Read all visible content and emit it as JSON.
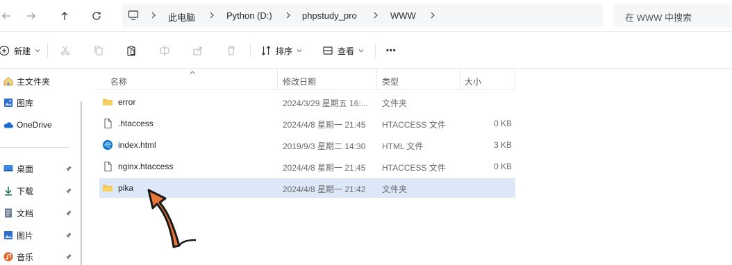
{
  "address": {
    "crumbs": [
      "此电脑",
      "Python (D:)",
      "phpstudy_pro",
      "WWW"
    ],
    "search_placeholder": "在 WWW 中搜索"
  },
  "toolbar": {
    "new_label": "新建",
    "sort_label": "排序",
    "view_label": "查看",
    "more_label": "•••"
  },
  "sidebar": {
    "top": [
      {
        "label": "主文件夹",
        "icon": "home-icon"
      },
      {
        "label": "图库",
        "icon": "gallery-icon"
      },
      {
        "label": "OneDrive",
        "icon": "cloud-icon"
      }
    ],
    "pinned": [
      {
        "label": "桌面",
        "icon": "desktop-icon"
      },
      {
        "label": "下载",
        "icon": "download-icon"
      },
      {
        "label": "文档",
        "icon": "document-icon"
      },
      {
        "label": "图片",
        "icon": "pictures-icon"
      },
      {
        "label": "音乐",
        "icon": "music-icon"
      }
    ]
  },
  "columns": {
    "name": "名称",
    "date": "修改日期",
    "type": "类型",
    "size": "大小"
  },
  "files": [
    {
      "name": "error",
      "date": "2024/3/29 星期五 16:...",
      "type": "文件夹",
      "size": "",
      "icon": "folder-icon"
    },
    {
      "name": ".htaccess",
      "date": "2024/4/8 星期一 21:45",
      "type": "HTACCESS 文件",
      "size": "0 KB",
      "icon": "file-icon"
    },
    {
      "name": "index.html",
      "date": "2019/9/3 星期二 14:30",
      "type": "HTML 文件",
      "size": "3 KB",
      "icon": "edge-icon"
    },
    {
      "name": "nginx.htaccess",
      "date": "2024/4/8 星期一 21:45",
      "type": "HTACCESS 文件",
      "size": "0 KB",
      "icon": "file-icon"
    },
    {
      "name": "pika",
      "date": "2024/4/8 星期一 21:42",
      "type": "文件夹",
      "size": "",
      "icon": "folder-icon",
      "selected": true
    }
  ],
  "colors": {
    "accent": "#dce8f7",
    "folder": "#f2c14e",
    "arrow": "#e8773a"
  }
}
